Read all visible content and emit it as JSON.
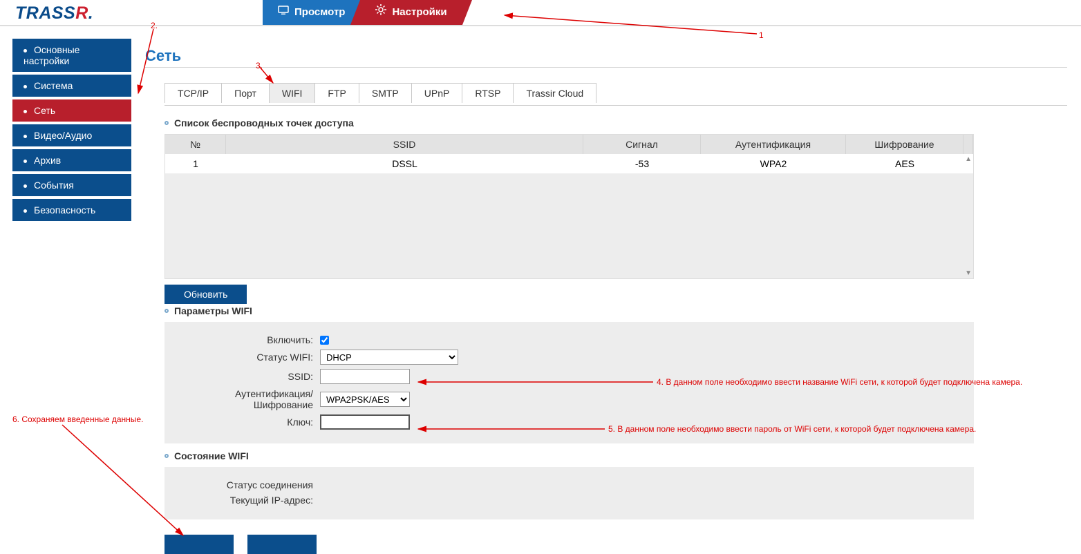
{
  "logo": {
    "text": "TRASS",
    "accent": "R"
  },
  "topbar": {
    "view_label": "Просмотр",
    "settings_label": "Настройки"
  },
  "sidebar": {
    "items": [
      {
        "label": "Основные настройки"
      },
      {
        "label": "Система"
      },
      {
        "label": "Сеть"
      },
      {
        "label": "Видео/Аудио"
      },
      {
        "label": "Архив"
      },
      {
        "label": "События"
      },
      {
        "label": "Безопасность"
      }
    ],
    "active_index": 2
  },
  "page_title": "Сеть",
  "tabs": [
    "TCP/IP",
    "Порт",
    "WIFI",
    "FTP",
    "SMTP",
    "UPnP",
    "RTSP",
    "Trassir Cloud"
  ],
  "active_tab_index": 2,
  "ap_list": {
    "heading": "Список беспроводных точек доступа",
    "columns": [
      "№",
      "SSID",
      "Сигнал",
      "Аутентификация",
      "Шифрование"
    ],
    "rows": [
      {
        "n": "1",
        "ssid": "DSSL",
        "signal": "-53",
        "auth": "WPA2",
        "enc": "AES"
      }
    ]
  },
  "refresh_label": "Обновить",
  "wifi_params": {
    "heading": "Параметры WIFI",
    "enable_label": "Включить:",
    "enabled": true,
    "status_label": "Статус WIFI:",
    "status_value": "DHCP",
    "ssid_label": "SSID:",
    "ssid_value": "",
    "auth_enc_label": "Аутентификация/Шифрование",
    "auth_enc_value": "WPA2PSK/AES",
    "key_label": "Ключ:",
    "key_value": ""
  },
  "wifi_state": {
    "heading": "Состояние WIFI",
    "conn_label": "Статус соединения",
    "ip_label": "Текущий IP-адрес:"
  },
  "annotations": {
    "n1": "1",
    "n2": "2.",
    "n3": "3.",
    "t4": "4. В данном поле необходимо ввести название WiFi сети, к которой будет подключена камера.",
    "t5": "5. В данном поле необходимо ввести пароль от WiFi сети, к которой будет подключена камера.",
    "t6": "6. Сохраняем введенные данные."
  }
}
